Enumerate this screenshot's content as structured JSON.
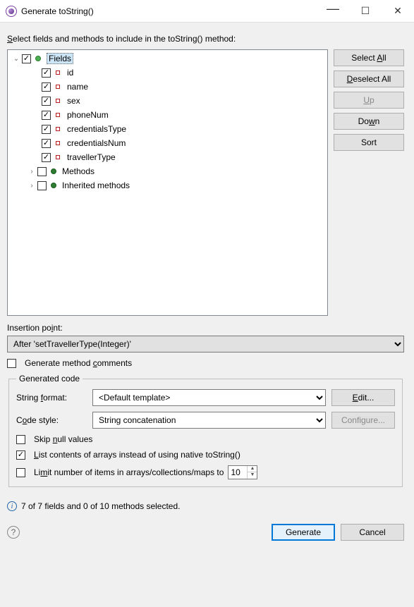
{
  "window": {
    "title": "Generate toString()"
  },
  "instruction": "Select fields and methods to include in the toString() method:",
  "instruction_uchar": "S",
  "tree": {
    "fields_label": "Fields",
    "items": [
      {
        "label": "id"
      },
      {
        "label": "name"
      },
      {
        "label": "sex"
      },
      {
        "label": "phoneNum"
      },
      {
        "label": "credentialsType"
      },
      {
        "label": "credentialsNum"
      },
      {
        "label": "travellerType"
      }
    ],
    "methods_label": "Methods",
    "inherited_label": "Inherited methods"
  },
  "buttons": {
    "select_all": "Select All",
    "deselect_all": "Deselect All",
    "up": "Up",
    "down": "Down",
    "sort": "Sort",
    "edit": "Edit...",
    "configure": "Configure...",
    "generate": "Generate",
    "cancel": "Cancel"
  },
  "insertion": {
    "label": "Insertion point:",
    "value": "After 'setTravellerType(Integer)'"
  },
  "gen_comments_label": "Generate method comments",
  "group": {
    "legend": "Generated code",
    "string_format_label": "String format:",
    "string_format_value": "<Default template>",
    "code_style_label": "Code style:",
    "code_style_value": "String concatenation",
    "skip_null_label": "Skip null values",
    "list_contents_label": "List contents of arrays instead of using native toString()",
    "limit_label": "Limit number of items in arrays/collections/maps to",
    "limit_value": "10"
  },
  "status": "7 of 7 fields and 0 of 10 methods selected."
}
